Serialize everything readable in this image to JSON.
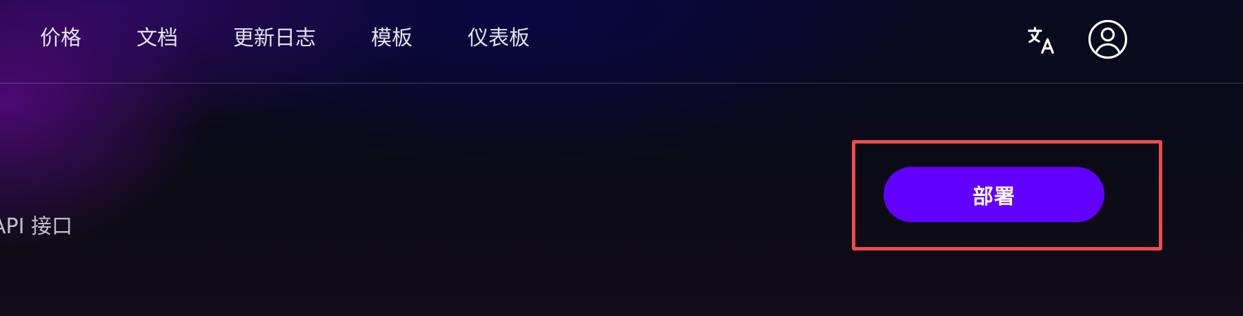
{
  "nav": {
    "items": [
      {
        "label": "价格"
      },
      {
        "label": "文档"
      },
      {
        "label": "更新日志"
      },
      {
        "label": "模板"
      },
      {
        "label": "仪表板"
      }
    ],
    "translate_icon": "translate-icon",
    "account_icon": "user-circle-icon"
  },
  "content": {
    "side_label": "API 接口"
  },
  "deploy": {
    "label": "部署",
    "highlighted": true
  },
  "colors": {
    "accent": "#6200ff",
    "highlight_border": "#ef4b4f",
    "nav_text": "#e4e2ec"
  }
}
